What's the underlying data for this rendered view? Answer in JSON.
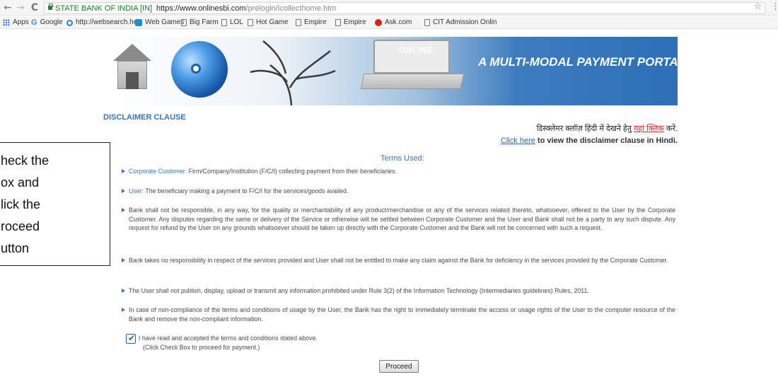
{
  "browser": {
    "site_identity": "STATE BANK OF INDIA [IN]",
    "url_domain": "https://www.onlinesbi.com",
    "url_path": "/prelogin/icollecthome.htm",
    "nav": {
      "back": "←",
      "forward": "→",
      "reload": "C"
    }
  },
  "bookmarks": [
    {
      "label": "Apps",
      "icon": "apps-grid-icon"
    },
    {
      "label": "Google",
      "icon": "google-icon"
    },
    {
      "label": "http://websearch.he",
      "icon": "opera-icon"
    },
    {
      "label": "Web Games",
      "icon": "web-games-icon"
    },
    {
      "label": "Big Farm",
      "icon": "page-icon"
    },
    {
      "label": "LOL",
      "icon": "page-icon"
    },
    {
      "label": "Hot Game",
      "icon": "page-icon"
    },
    {
      "label": "Empire",
      "icon": "page-icon"
    },
    {
      "label": "Empire",
      "icon": "page-icon"
    },
    {
      "label": "Ask.com",
      "icon": "ask-icon"
    },
    {
      "label": "CIT Admission Onlin",
      "icon": "page-icon"
    }
  ],
  "banner": {
    "online_label": "ONLINE",
    "title": "A MULTI-MODAL PAYMENT PORTAL"
  },
  "disclaimer": {
    "heading": "DISCLAIMER CLAUSE",
    "hindi_prefix": "डिस्क्लेमर क्लॉज़ हिंदी में देखने हेतु ",
    "hindi_link": "यहां क्लिक",
    "hindi_suffix": " करें.",
    "click_link": "Click here",
    "click_rest": " to view the disclaimer clause in Hindi."
  },
  "terms": {
    "heading": "Terms Used:",
    "items": [
      {
        "key": "Corporate Customer:",
        "text": " Firm/Company/Institution (F/C/I) collecting payment from their beneficiaries."
      },
      {
        "key": "User:",
        "text": " The beneficiary making a payment to F/C/I for the services/goods availed."
      },
      {
        "key": "",
        "text": "Bank shall not be responsible, in any way, for the quality or merchantability of any product/merchandise or any of the services related thereto, whatsoever, offered to the User by the Corporate Customer. Any disputes regarding the same or delivery of the Service or otherwise will be settled between Corporate Customer and the User and Bank shall not be a party to any such dispute. Any request for refund by the User on any grounds whatsoever should be taken up directly with the Corporate Customer and the Bank will not be concerned with such a request."
      },
      {
        "key": "",
        "text": "Bank takes no responsibility in respect of the services provided and User shall not be entitled to make any claim against the Bank for deficiency in the services provided by the Corporate Customer."
      },
      {
        "key": "",
        "text": "The User shall not publish, display, upload or transmit any information prohibited under Rule 3(2) of the Information Technology (Intermediaries guidelines) Rules, 2011."
      },
      {
        "key": "",
        "text": "In case of non-compliance of the terms and conditions of usage by the User, the Bank has the right to immediately terminate the access or usage rights of the User to the computer resource of the Bank and remove the non-compliant information."
      }
    ]
  },
  "acceptance": {
    "checkbox_checked": true,
    "checkbox_mark": "✔",
    "label": "I have read and accepted the terms and conditions stated above.",
    "hint": "(Click Check Box to proceed for payment.)"
  },
  "proceed_label": "Proceed",
  "callout": {
    "lines": [
      "heck the",
      "ox and",
      "lick the",
      "roceed",
      "utton"
    ]
  },
  "colors": {
    "accent_blue": "#3c73b5",
    "link_blue": "#2e64b4",
    "hindi_link_red": "#d42222"
  }
}
